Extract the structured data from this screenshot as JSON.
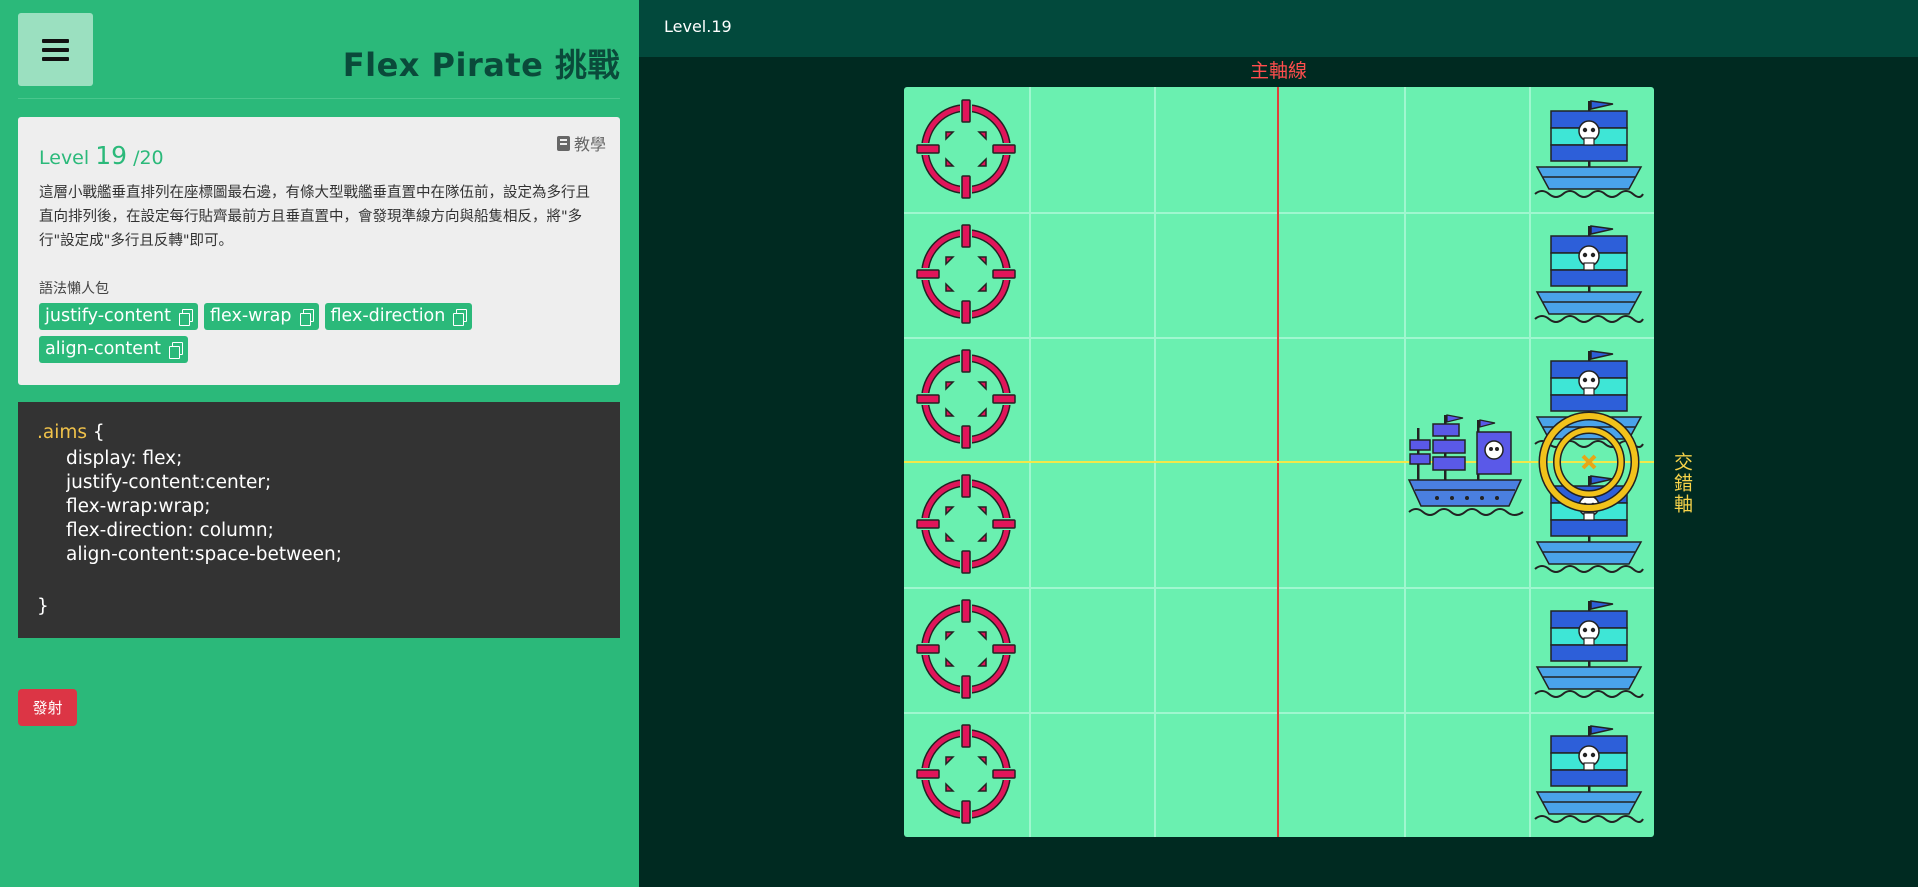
{
  "sidebar": {
    "title": "Flex Pirate 挑戰",
    "level": {
      "prefix": "Level",
      "current": "19",
      "total": "/20",
      "tutorial_label": "教學",
      "description": "這層小戰艦垂直排列在座標圖最右邊，有條大型戰艦垂直置中在隊伍前，設定為多行且直向排列後，在設定每行貼齊最前方且垂直置中，會發現準線方向與船隻相反，將\"多行\"設定成\"多行且反轉\"即可。",
      "snippets_label": "語法懶人包",
      "snippets": [
        "justify-content",
        "flex-wrap",
        "flex-direction",
        "align-content"
      ]
    },
    "code": {
      "selector": ".aims",
      "open_brace": "{",
      "body": "display: flex;\njustify-content:center;\nflex-wrap:wrap;\nflex-direction: column;\nalign-content:space-between;",
      "close_brace": "}"
    },
    "fire_label": "發射"
  },
  "game": {
    "level_tag": "Level.19",
    "main_axis_label": "主軸線",
    "cross_axis_label": "交錯軸",
    "colors": {
      "board": "#6af0b0",
      "aim": "#e0155a",
      "main_axis": "#e0403a",
      "cross_axis": "#f2e84a"
    },
    "aims_count": 6,
    "enemy_ships_count": 6
  }
}
